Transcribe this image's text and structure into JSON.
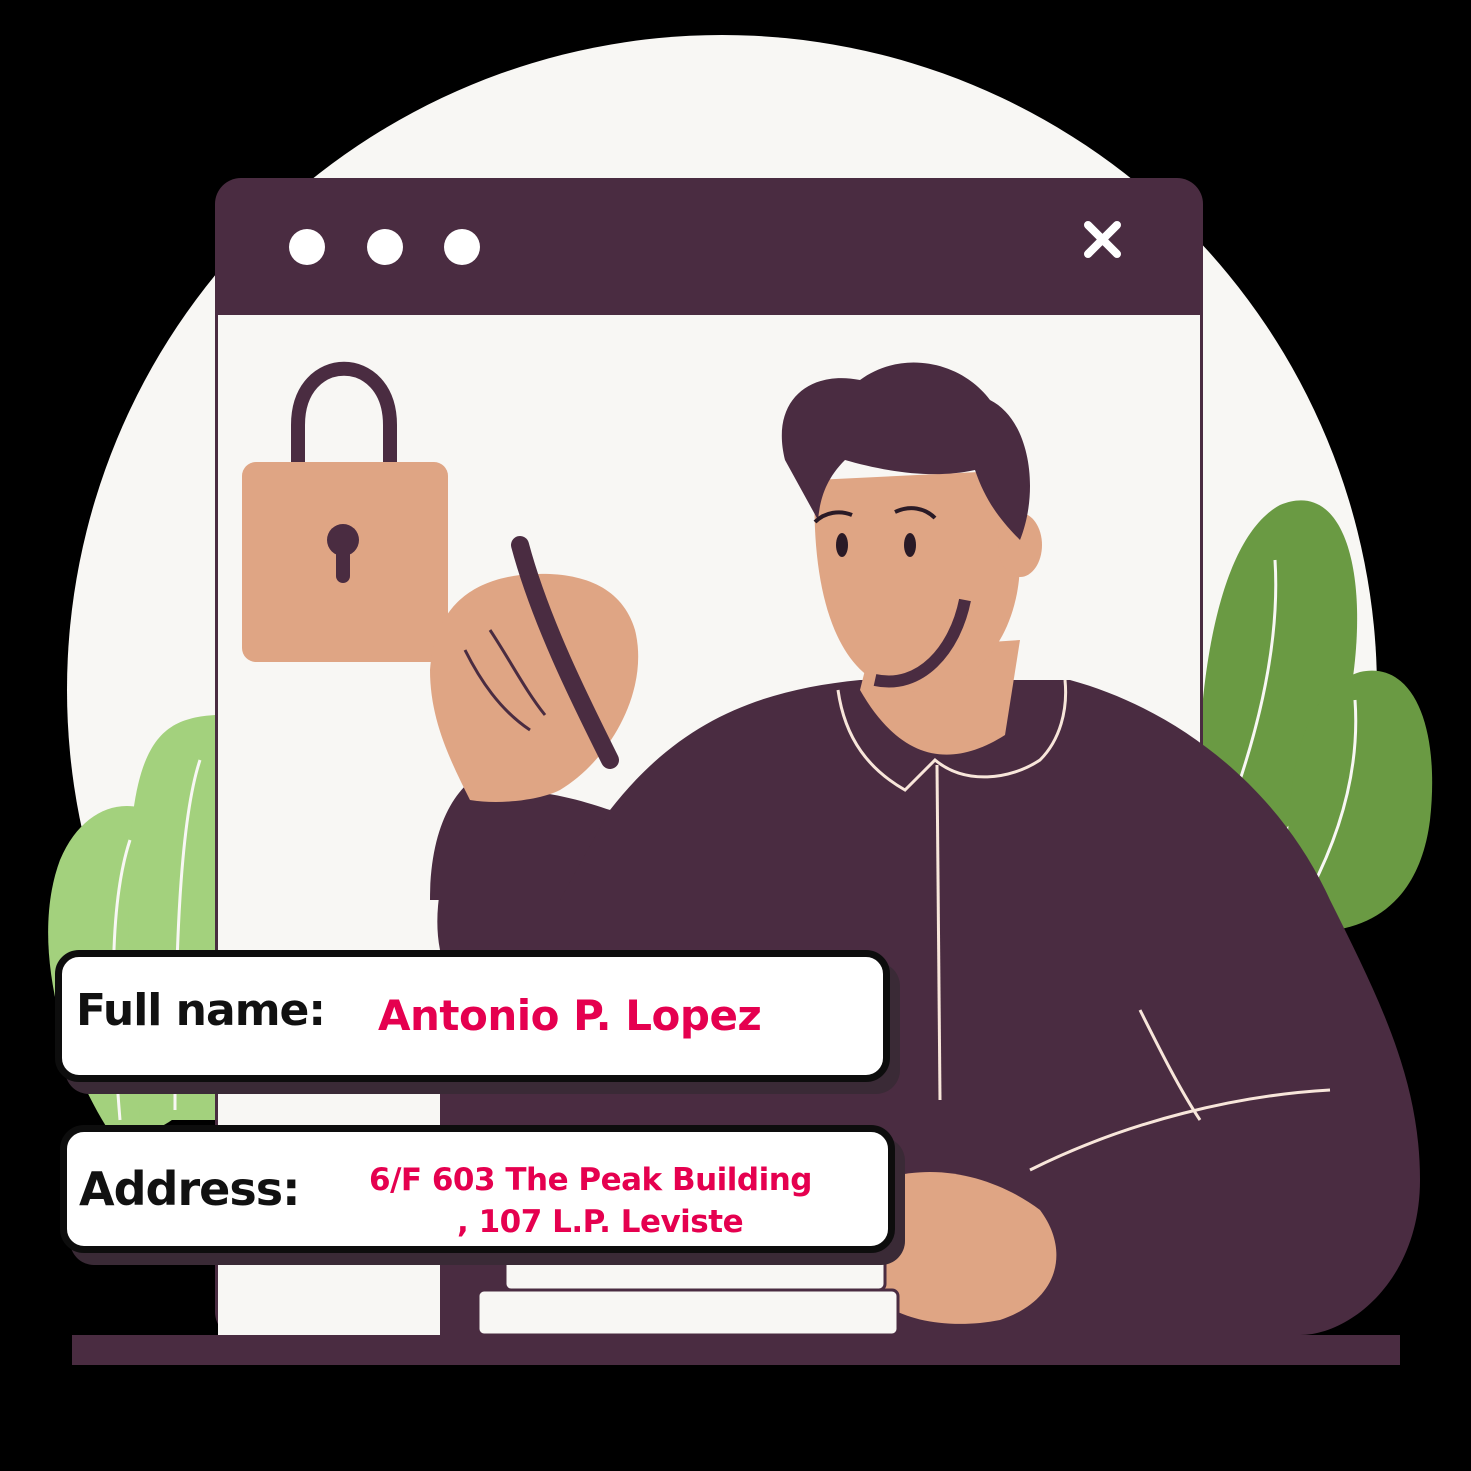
{
  "form": {
    "full_name_label": "Full name:",
    "full_name_value": "Antonio P. Lopez",
    "address_label": "Address:",
    "address_line1": "6/F 603 The Peak Building",
    "address_line2": ", 107 L.P. Leviste"
  },
  "icons": {
    "window_dots": "three-dots-icon",
    "window_close": "close-icon",
    "lock": "padlock-icon"
  },
  "colors": {
    "value_text": "#e5004f",
    "window_frame": "#4a2c41",
    "skin": "#dfa584",
    "plant_light": "#a3d17d",
    "plant_dark": "#6a9a43",
    "background": "#000000"
  }
}
